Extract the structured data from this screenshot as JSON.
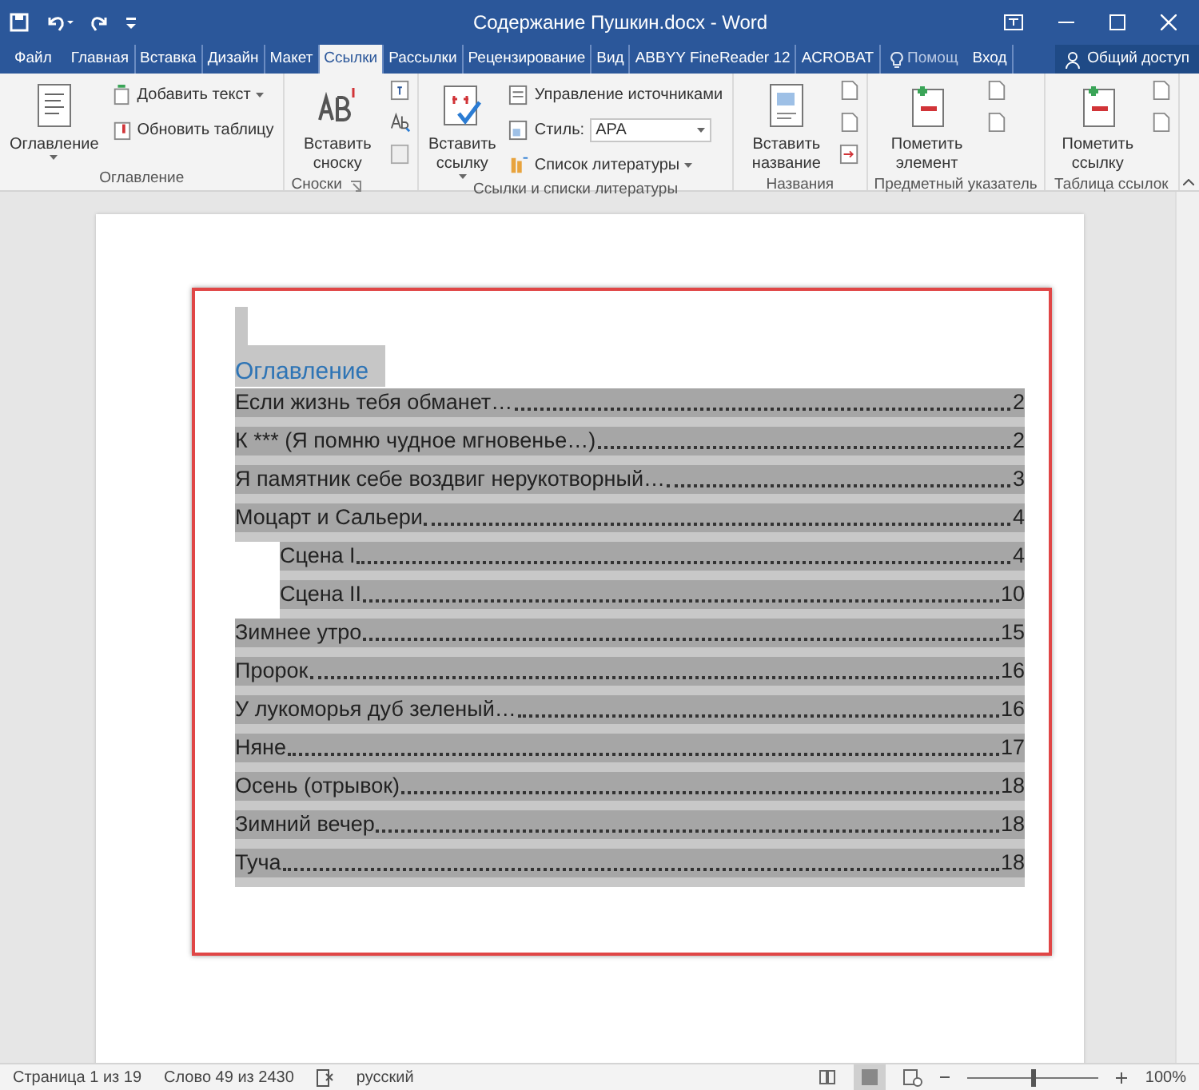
{
  "window": {
    "title": "Содержание Пушкин.docx - Word"
  },
  "tabs": [
    {
      "label": "Файл",
      "selected": false
    },
    {
      "label": "Главная",
      "selected": false
    },
    {
      "label": "Вставка",
      "selected": false
    },
    {
      "label": "Дизайн",
      "selected": false
    },
    {
      "label": "Макет",
      "selected": false
    },
    {
      "label": "Ссылки",
      "selected": true
    },
    {
      "label": "Рассылки",
      "selected": false
    },
    {
      "label": "Рецензирование",
      "selected": false
    },
    {
      "label": "Вид",
      "selected": false
    },
    {
      "label": "ABBYY FineReader 12",
      "selected": false
    },
    {
      "label": "ACROBAT",
      "selected": false
    }
  ],
  "tell_me": {
    "placeholder": "Помощ"
  },
  "sign_in": "Вход",
  "share": "Общий доступ",
  "ribbon_groups": [
    {
      "label": "Оглавление",
      "large": {
        "label": "Оглавление",
        "dropdown": true
      },
      "small": [
        {
          "label": "Добавить текст",
          "dropdown": true
        },
        {
          "label": "Обновить таблицу"
        }
      ]
    },
    {
      "label": "Сноски",
      "large": {
        "label": "Вставить сноску"
      },
      "launcher": true
    },
    {
      "label": "Ссылки и списки литературы",
      "large": {
        "label": "Вставить ссылку",
        "dropdown": true
      },
      "small": [
        {
          "label": "Управление источниками"
        },
        {
          "label": "Стиль:",
          "select": "APA"
        },
        {
          "label": "Список литературы",
          "dropdown": true
        }
      ]
    },
    {
      "label": "Названия",
      "large": {
        "label": "Вставить название"
      }
    },
    {
      "label": "Предметный указатель",
      "large": {
        "label": "Пометить элемент"
      }
    },
    {
      "label": "Таблица ссылок",
      "large": {
        "label": "Пометить ссылку"
      }
    }
  ],
  "document": {
    "toc_heading": "Оглавление",
    "entries": [
      {
        "title": "Если жизнь тебя обманет…",
        "page": "2"
      },
      {
        "title": "К *** (Я помню чудное мгновенье…)",
        "page": "2"
      },
      {
        "title": "Я памятник себе воздвиг нерукотворный…",
        "page": "3"
      },
      {
        "title": "Моцарт и Сальери",
        "page": "4",
        "children": [
          {
            "title": "Сцена I",
            "page": "4"
          },
          {
            "title": "Сцена II",
            "page": "10"
          }
        ]
      },
      {
        "title": "Зимнее утро",
        "page": "15"
      },
      {
        "title": "Пророк",
        "page": "16"
      },
      {
        "title": "У лукоморья дуб зеленый…",
        "page": "16"
      },
      {
        "title": "Няне",
        "page": "17"
      },
      {
        "title": "Осень (отрывок)",
        "page": "18"
      },
      {
        "title": "Зимний вечер",
        "page": "18"
      },
      {
        "title": "Туча",
        "page": "18"
      }
    ]
  },
  "status_bar": {
    "page": "Страница 1 из 19",
    "words": "Слово 49 из 2430",
    "language": "русский",
    "zoom": {
      "level": 0.5
    },
    "zoom_text": "100%"
  }
}
